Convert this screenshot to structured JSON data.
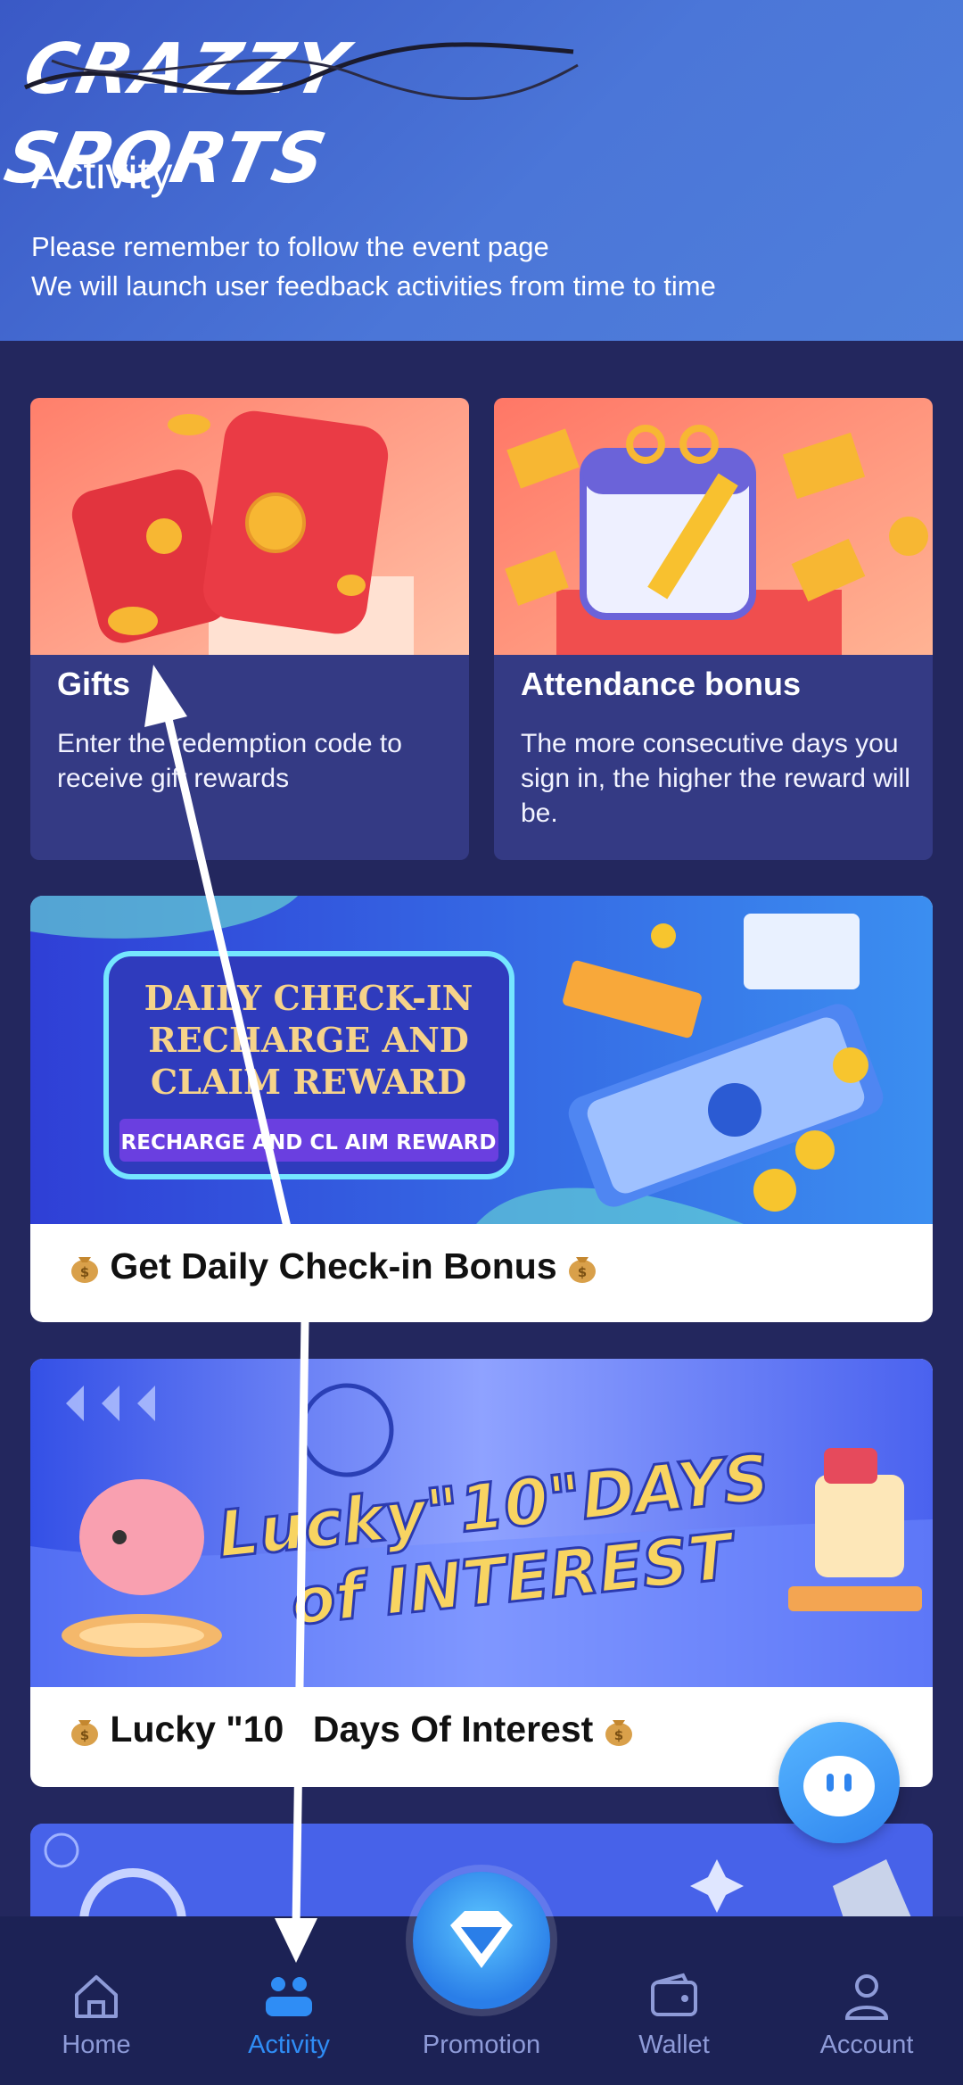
{
  "brand": {
    "logo_text": "CRAZZY SPORTS"
  },
  "header": {
    "title": "Activity",
    "desc_line1": "Please remember to follow the event page",
    "desc_line2": "We will launch user feedback activities from time to time"
  },
  "cards": [
    {
      "title": "Gifts",
      "desc": "Enter the redemption code to receive gift rewards"
    },
    {
      "title": "Attendance bonus",
      "desc": "The more consecutive days you sign in, the higher the reward will be."
    }
  ],
  "banners": [
    {
      "headline1": "DAILY CHECK-IN",
      "headline2": "RECHARGE AND",
      "headline3": "CLAIM REWARD",
      "subline": "RECHARGE AND CL AIM REWARD",
      "caption": "Get Daily Check-in Bonus"
    },
    {
      "headline1": "Lucky\"10\"DAYS",
      "headline2": "of INTEREST",
      "caption": "Lucky \"10 ' Days Of Interest"
    }
  ],
  "nav": {
    "items": [
      {
        "label": "Home",
        "icon": "home-icon"
      },
      {
        "label": "Activity",
        "icon": "activity-icon"
      },
      {
        "label": "Promotion",
        "icon": "diamond-icon"
      },
      {
        "label": "Wallet",
        "icon": "wallet-icon"
      },
      {
        "label": "Account",
        "icon": "account-icon"
      }
    ],
    "active": "Activity"
  },
  "colors": {
    "background": "#23275e",
    "header_gradient_start": "#3a59c6",
    "header_gradient_end": "#4f7fdb",
    "card": "#343a84",
    "nav_background": "#1c2255",
    "nav_active": "#2f8df5",
    "nav_inactive": "#8e9bd8"
  }
}
